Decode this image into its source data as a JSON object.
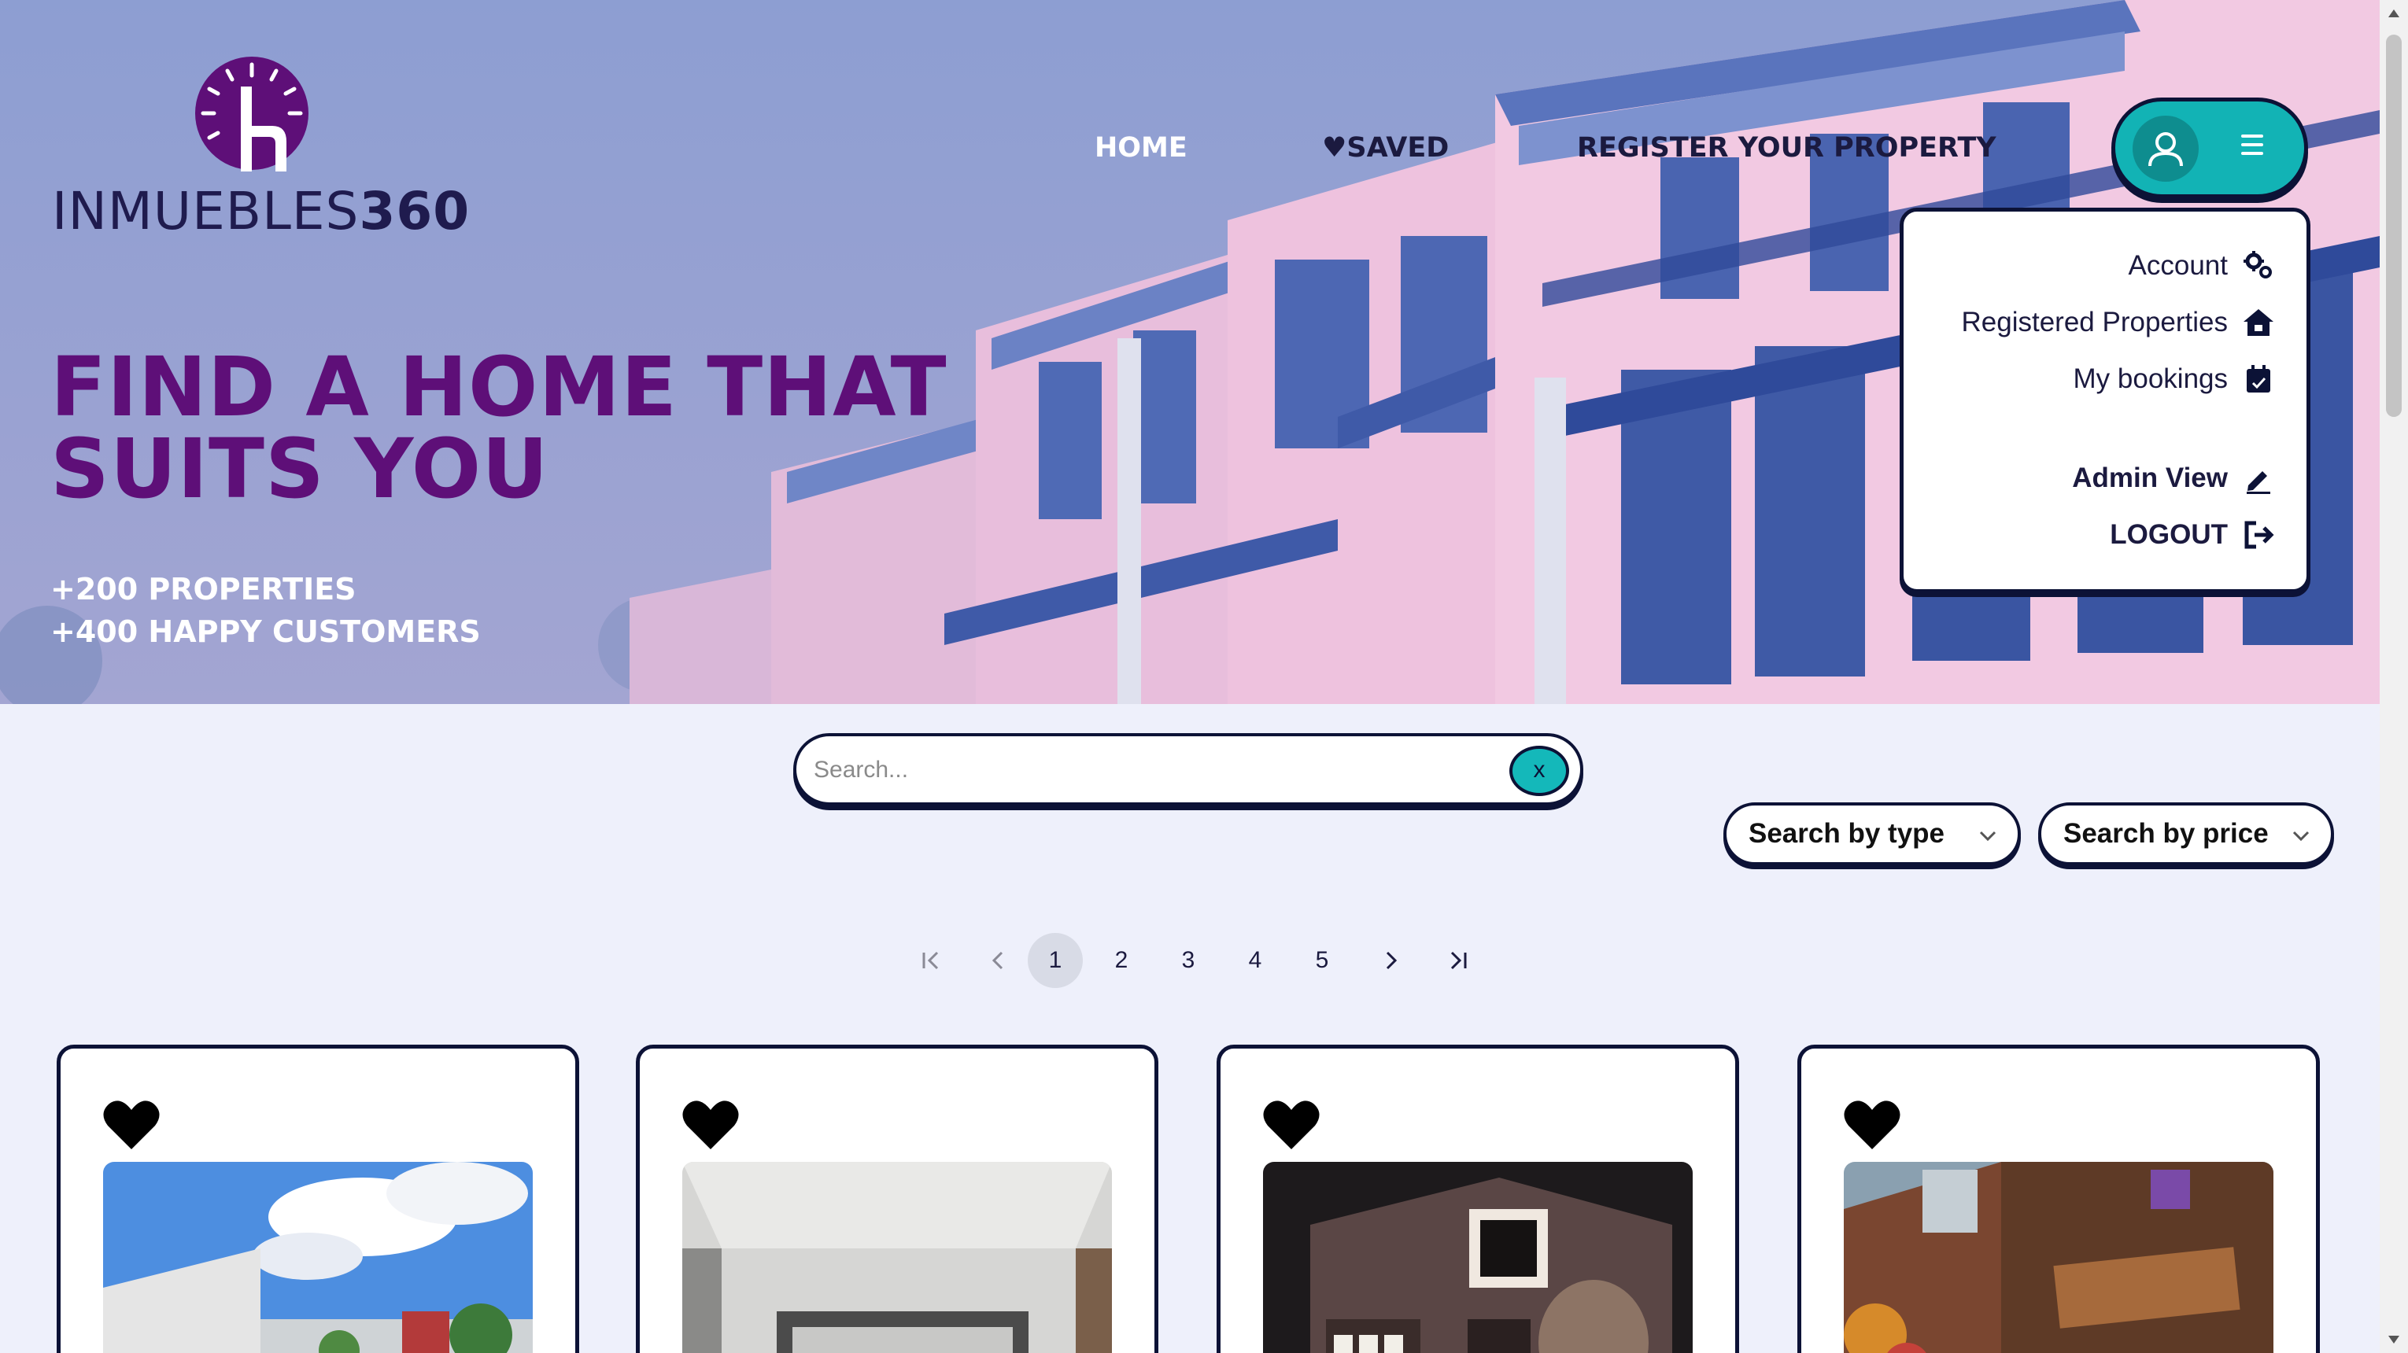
{
  "brand": {
    "name_light": "INMUEBLES",
    "name_bold": "360"
  },
  "nav": {
    "home": "HOME",
    "saved": "♥SAVED",
    "register": "REGISTER YOUR PROPERTY"
  },
  "user_menu": {
    "items": [
      {
        "label": "Account",
        "icon": "gears-icon"
      },
      {
        "label": "Registered Properties",
        "icon": "house-icon"
      },
      {
        "label": "My bookings",
        "icon": "calendar-icon"
      },
      {
        "label": "Admin View",
        "icon": "pencil-icon"
      },
      {
        "label": "LOGOUT",
        "icon": "logout-icon"
      }
    ]
  },
  "hero": {
    "headline_line1": "FIND A HOME THAT",
    "headline_line2": "SUITS YOU",
    "stat1": "+200 PROPERTIES",
    "stat2": "+400 HAPPY CUSTOMERS"
  },
  "search": {
    "placeholder": "Search...",
    "clear_label": "x"
  },
  "filters": {
    "type_label": "Search by type",
    "price_label": "Search by price"
  },
  "pagination": {
    "pages": [
      "1",
      "2",
      "3",
      "4",
      "5"
    ],
    "current": "1"
  },
  "colors": {
    "accent": "#12b3b5",
    "headline": "#5e0f78",
    "outline": "#0c1236",
    "background": "#eef0fb"
  }
}
